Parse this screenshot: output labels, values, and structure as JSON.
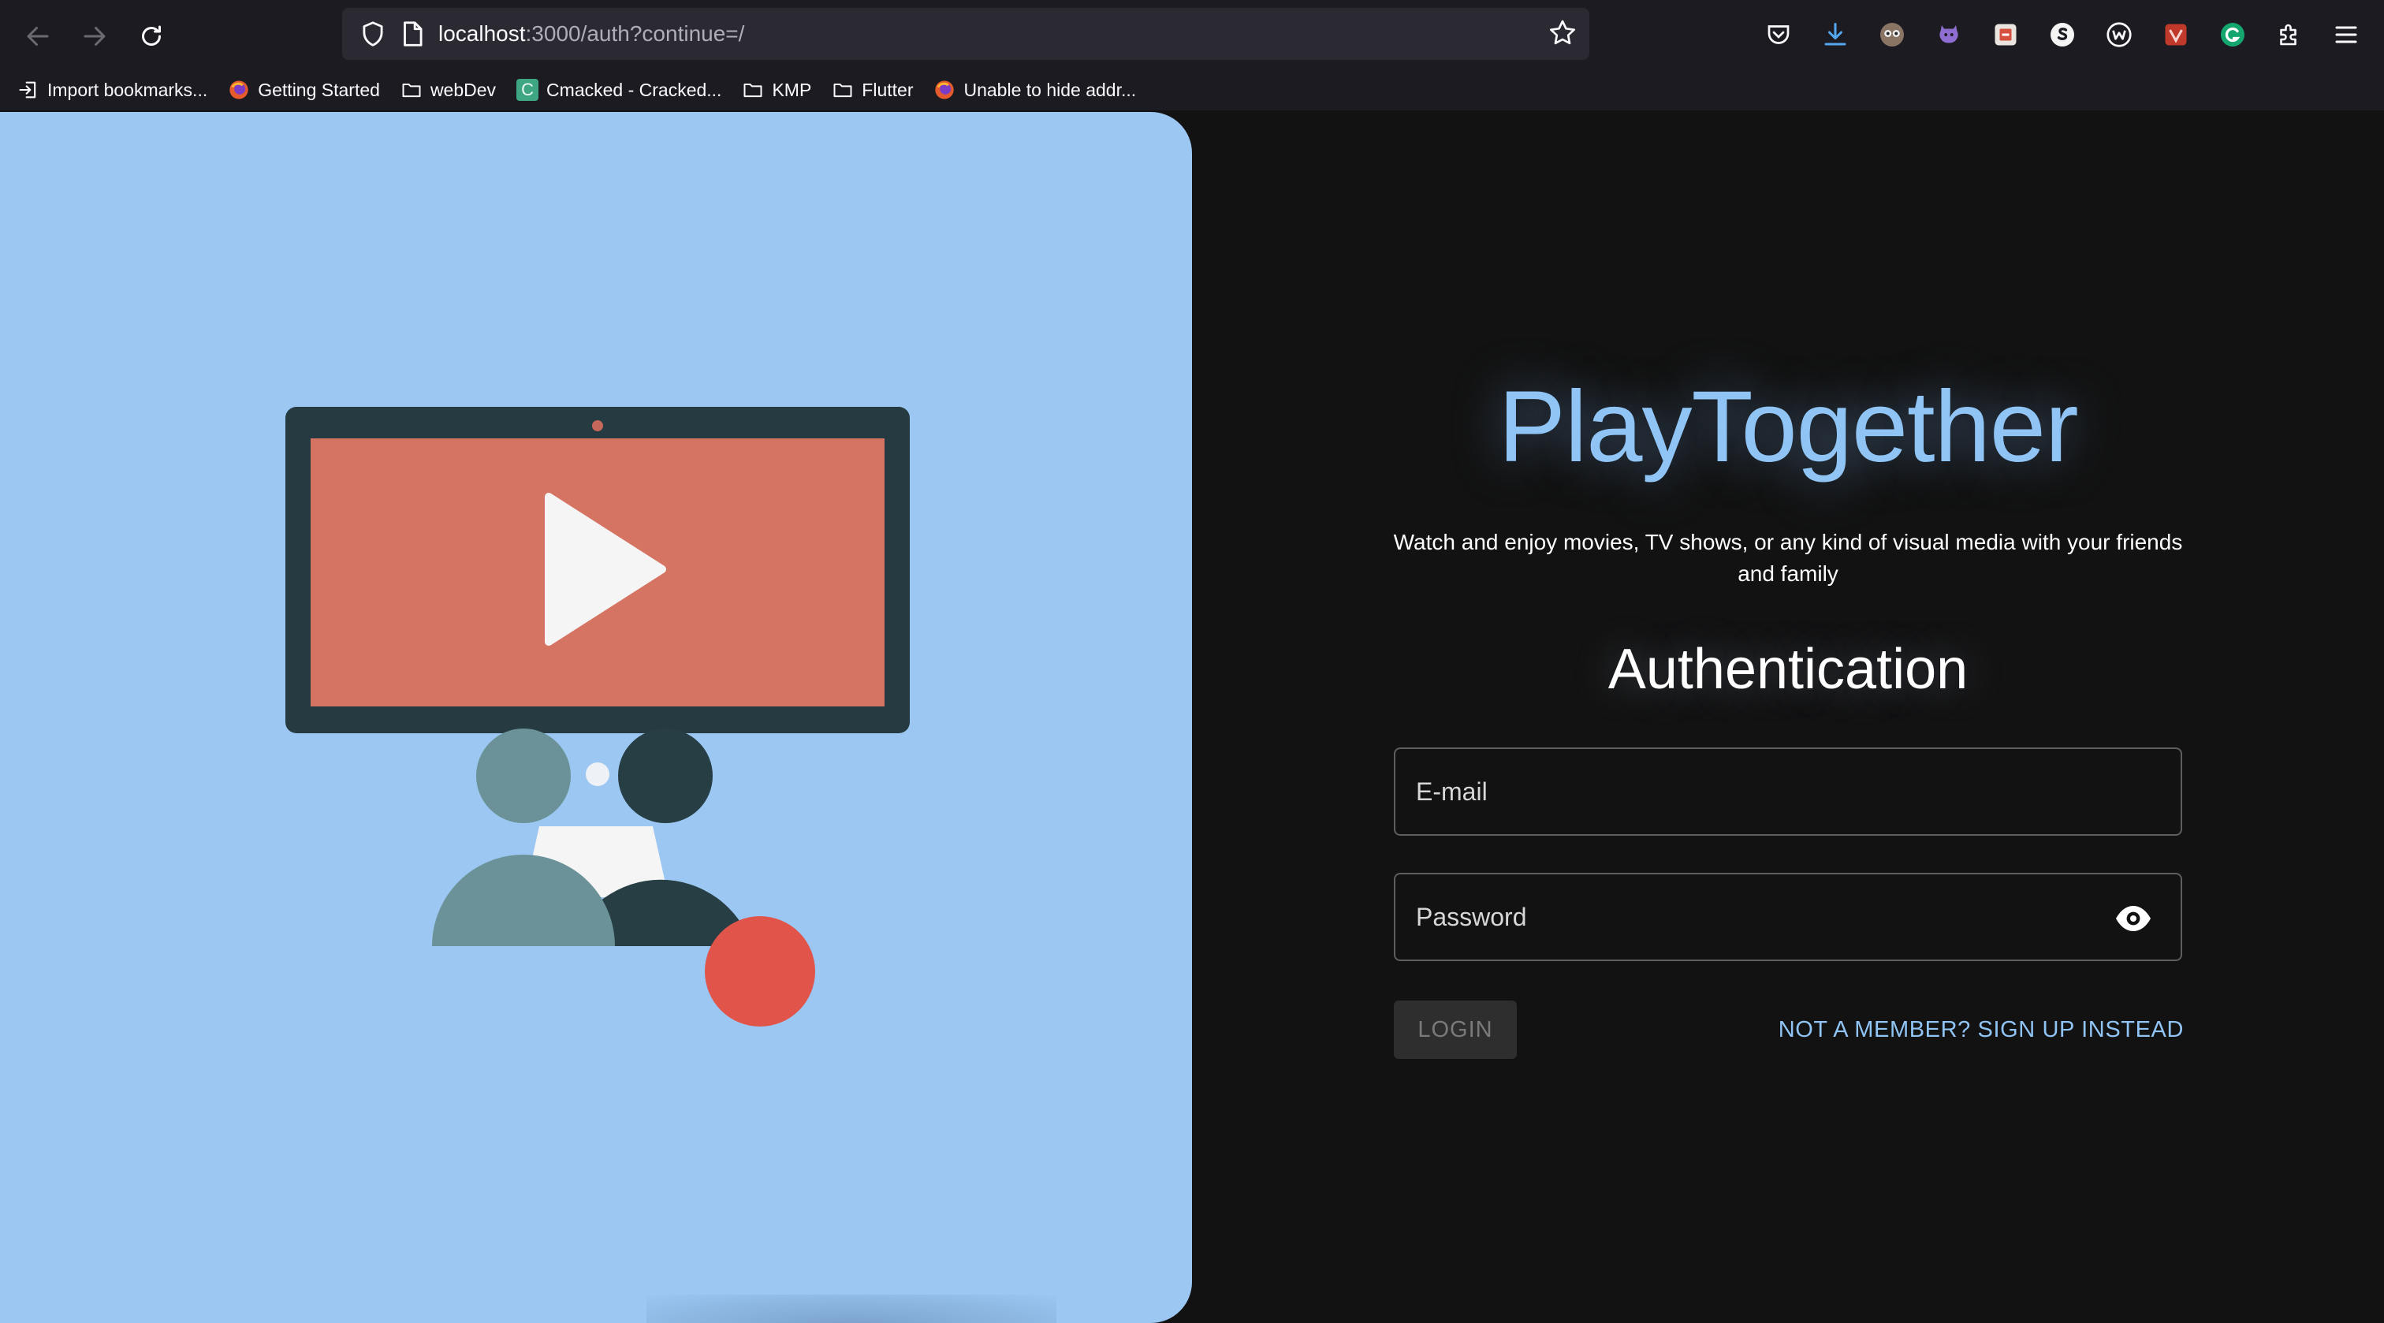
{
  "browser": {
    "url_host": "localhost",
    "url_rest": ":3000/auth?continue=/",
    "bookmarks": [
      {
        "label": "Import bookmarks...",
        "icon": "import-icon"
      },
      {
        "label": "Getting Started",
        "icon": "firefox-icon"
      },
      {
        "label": "webDev",
        "icon": "folder-icon"
      },
      {
        "label": "Cmacked - Cracked...",
        "icon": "c-site-icon"
      },
      {
        "label": "KMP",
        "icon": "folder-icon"
      },
      {
        "label": "Flutter",
        "icon": "folder-icon"
      },
      {
        "label": "Unable to hide addr...",
        "icon": "firefox-icon"
      }
    ],
    "c_icon_letter": "C"
  },
  "app": {
    "brand": "PlayTogether",
    "tagline": "Watch and enjoy movies, TV shows, or any kind of visual media with your friends and family",
    "auth_title": "Authentication",
    "email_placeholder": "E-mail",
    "password_placeholder": "Password",
    "login_label": "LOGIN",
    "signup_label": "NOT A MEMBER? SIGN UP INSTEAD"
  },
  "colors": {
    "panel_bg": "#9bc7f2",
    "accent": "#90c4f5",
    "screen": "#d67463",
    "monitor": "#263a42",
    "person_light": "#6b9298",
    "person_dark": "#263e44",
    "record": "#e0544a"
  }
}
